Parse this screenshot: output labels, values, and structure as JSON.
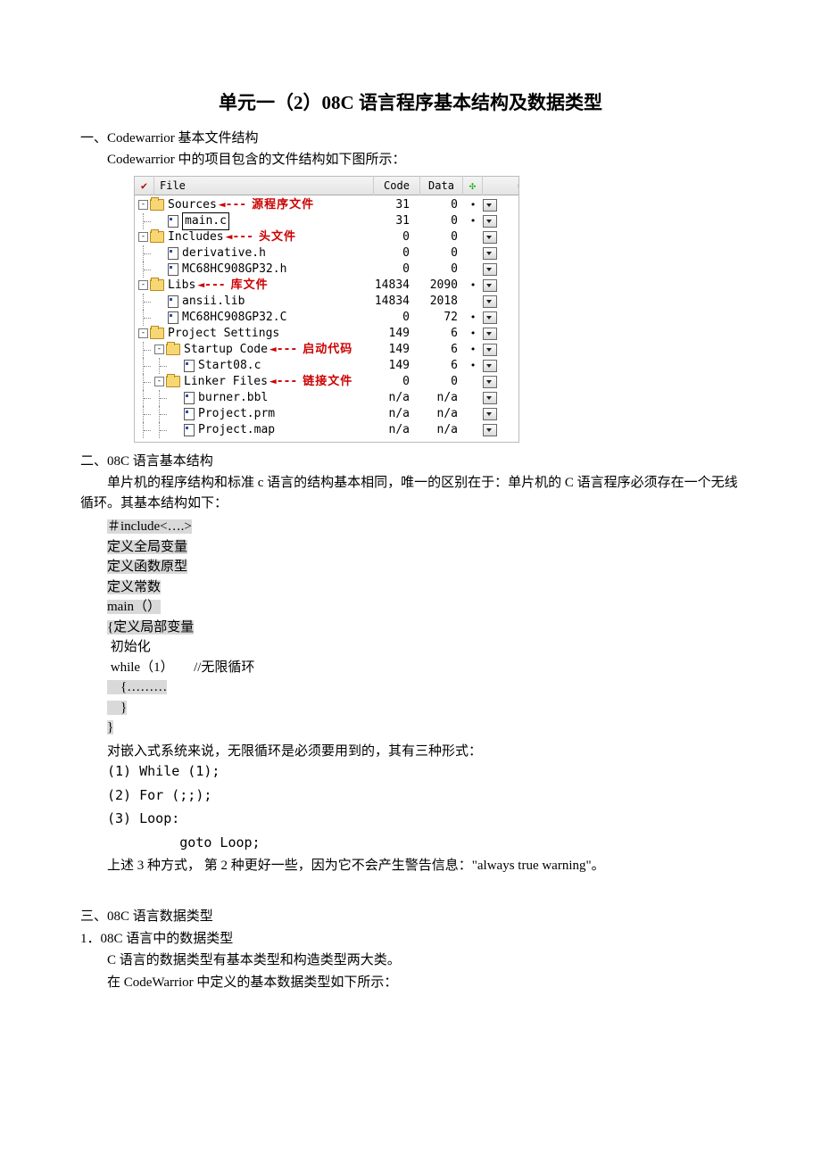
{
  "title": "单元一（2）08C 语言程序基本结构及数据类型",
  "section1": {
    "heading": "一、Codewarrior 基本文件结构",
    "intro": "Codewarrior 中的项目包含的文件结构如下图所示：",
    "headers": {
      "file": "File",
      "code": "Code",
      "data": "Data"
    },
    "annotations": {
      "sources": "源程序文件",
      "includes": "头文件",
      "libs": "库文件",
      "startup": "启动代码",
      "linker": "链接文件"
    },
    "rows": [
      {
        "indent": 0,
        "exp": "-",
        "icon": "folder",
        "name": "Sources",
        "annot": "sources",
        "code": "31",
        "data": "0",
        "dot": "•",
        "sel": false
      },
      {
        "indent": 1,
        "exp": "",
        "icon": "file",
        "name": "main.c",
        "code": "31",
        "data": "0",
        "dot": "•",
        "sel": true
      },
      {
        "indent": 0,
        "exp": "-",
        "icon": "folder",
        "name": "Includes",
        "annot": "includes",
        "code": "0",
        "data": "0",
        "dot": "",
        "sel": false
      },
      {
        "indent": 1,
        "exp": "",
        "icon": "file",
        "name": "derivative.h",
        "code": "0",
        "data": "0",
        "dot": "",
        "sel": false
      },
      {
        "indent": 1,
        "exp": "",
        "icon": "file",
        "name": "MC68HC908GP32.h",
        "code": "0",
        "data": "0",
        "dot": "",
        "sel": false
      },
      {
        "indent": 0,
        "exp": "-",
        "icon": "folder",
        "name": "Libs",
        "annot": "libs",
        "code": "14834",
        "data": "2090",
        "dot": "•",
        "sel": false
      },
      {
        "indent": 1,
        "exp": "",
        "icon": "file",
        "name": "ansii.lib",
        "code": "14834",
        "data": "2018",
        "dot": "",
        "sel": false
      },
      {
        "indent": 1,
        "exp": "",
        "icon": "file",
        "name": "MC68HC908GP32.C",
        "code": "0",
        "data": "72",
        "dot": "•",
        "sel": false
      },
      {
        "indent": 0,
        "exp": "-",
        "icon": "folder",
        "name": "Project Settings",
        "code": "149",
        "data": "6",
        "dot": "•",
        "sel": false
      },
      {
        "indent": 1,
        "exp": "-",
        "icon": "folder",
        "name": "Startup Code",
        "annot": "startup",
        "code": "149",
        "data": "6",
        "dot": "•",
        "sel": false
      },
      {
        "indent": 2,
        "exp": "",
        "icon": "file",
        "name": "Start08.c",
        "code": "149",
        "data": "6",
        "dot": "•",
        "sel": false
      },
      {
        "indent": 1,
        "exp": "-",
        "icon": "folder",
        "name": "Linker Files",
        "annot": "linker",
        "code": "0",
        "data": "0",
        "dot": "",
        "sel": false
      },
      {
        "indent": 2,
        "exp": "",
        "icon": "file",
        "name": "burner.bbl",
        "code": "n/a",
        "data": "n/a",
        "dot": "",
        "sel": false
      },
      {
        "indent": 2,
        "exp": "",
        "icon": "file",
        "name": "Project.prm",
        "code": "n/a",
        "data": "n/a",
        "dot": "",
        "sel": false
      },
      {
        "indent": 2,
        "exp": "",
        "icon": "file",
        "name": "Project.map",
        "code": "n/a",
        "data": "n/a",
        "dot": "",
        "sel": false
      }
    ]
  },
  "section2": {
    "heading": "二、08C 语言基本结构",
    "intro": "单片机的程序结构和标准 c 语言的结构基本相同，唯一的区别在于：单片机的 C 语言程序必须存在一个无线循环。其基本结构如下：",
    "code": {
      "l1": "＃include<….>",
      "l2": "定义全局变量",
      "l3": "定义函数原型",
      "l4": "定义常数",
      "l5": "main（）",
      "l6": "{定义局部变量",
      "l7": " 初始化",
      "l8": " while（1）      //无限循环",
      "l9": "    {………",
      "l10": "    }",
      "l11": "}"
    },
    "after_code": "对嵌入式系统来说，无限循环是必须要用到的，其有三种形式：",
    "items": {
      "i1": "(1) While (1);",
      "i2": "(2) For (;;);",
      "i3": "(3) Loop:",
      "i3b": "         goto Loop;"
    },
    "note": "上述 3 种方式， 第 2 种更好一些，因为它不会产生警告信息：\"always true warning\"。"
  },
  "section3": {
    "heading": "三、08C 语言数据类型",
    "sub1": "1．08C 语言中的数据类型",
    "p1": "C 语言的数据类型有基本类型和构造类型两大类。",
    "p2": "在 CodeWarrior 中定义的基本数据类型如下所示："
  }
}
